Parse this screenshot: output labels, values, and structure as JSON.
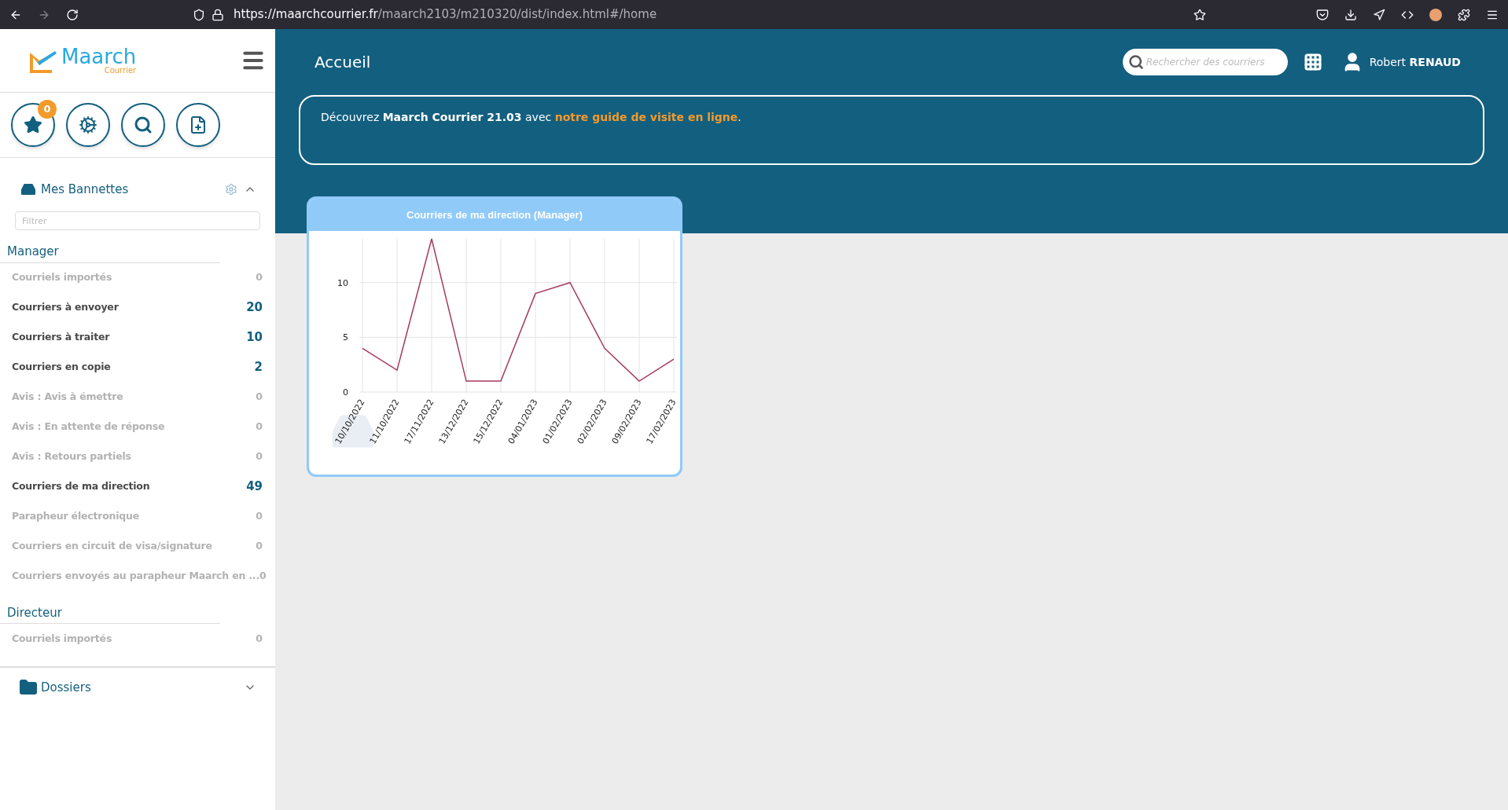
{
  "browser": {
    "url_host": "https://maarchcourrier.fr",
    "url_path": "/maarch2103/m210320/dist/index.html#/home",
    "forward_disabled": true
  },
  "logo": {
    "name": "Maarch",
    "sub": "Courrier"
  },
  "quick_actions": [
    {
      "kind": "favorites",
      "badge": "0"
    },
    {
      "kind": "admin"
    },
    {
      "kind": "search"
    },
    {
      "kind": "new"
    }
  ],
  "baskets": {
    "title": "Mes Bannettes",
    "expanded": true,
    "filter_placeholder": "Filtrer",
    "groups": [
      {
        "name": "Manager",
        "items": [
          {
            "label": "Courriels importés",
            "count": "0",
            "active": false
          },
          {
            "label": "Courriers à envoyer",
            "count": "20",
            "active": true
          },
          {
            "label": "Courriers à traiter",
            "count": "10",
            "active": true
          },
          {
            "label": "Courriers en copie",
            "count": "2",
            "active": true
          },
          {
            "label": "Avis : Avis à émettre",
            "count": "0",
            "active": false
          },
          {
            "label": "Avis : En attente de réponse",
            "count": "0",
            "active": false
          },
          {
            "label": "Avis : Retours partiels",
            "count": "0",
            "active": false
          },
          {
            "label": "Courriers de ma direction",
            "count": "49",
            "active": true
          },
          {
            "label": "Parapheur électronique",
            "count": "0",
            "active": false
          },
          {
            "label": "Courriers en circuit de visa/signature",
            "count": "0",
            "active": false
          },
          {
            "label": "Courriers envoyés au parapheur Maarch en ...",
            "count": "0",
            "active": false
          }
        ]
      },
      {
        "name": "Directeur",
        "items": [
          {
            "label": "Courriels importés",
            "count": "0",
            "active": false
          }
        ]
      }
    ]
  },
  "folders": {
    "title": "Dossiers",
    "expanded": false
  },
  "header": {
    "title": "Accueil",
    "search_placeholder": "Rechercher des courriers",
    "user_first": "Robert",
    "user_last": "RENAUD"
  },
  "banner": {
    "text": "Découvrez **Maarch Courrier 21.03** avec ",
    "link": "notre guide de visite en ligne",
    "text_after": "."
  },
  "widget": {
    "title": "Courriers de ma direction (Manager)",
    "chart_data": {
      "type": "line",
      "categories": [
        "10/10/2022",
        "11/10/2022",
        "17/11/2022",
        "13/12/2022",
        "15/12/2022",
        "04/01/2023",
        "01/02/2023",
        "02/02/2023",
        "09/02/2023",
        "17/02/2023"
      ],
      "series": [
        {
          "color": "#a63a5c",
          "values": [
            4,
            2,
            14,
            1,
            1,
            9,
            10,
            4,
            1,
            3
          ]
        }
      ],
      "ylim": [
        0,
        14
      ],
      "yticks": [
        0,
        5,
        10
      ]
    }
  }
}
